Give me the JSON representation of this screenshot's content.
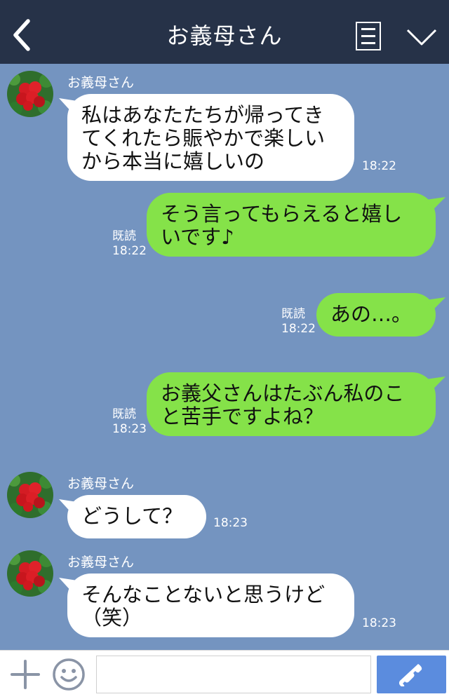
{
  "header": {
    "title": "お義母さん",
    "back_icon": "chevron-left-icon",
    "menu_icon": "menu-icon",
    "collapse_icon": "chevron-down-icon"
  },
  "messages": [
    {
      "direction": "in",
      "sender": "お義母さん",
      "text": "私はあなたたちが帰ってき\nてくれたら賑やかで楽しい\nから本当に嬉しいの",
      "time": "18:22"
    },
    {
      "direction": "out",
      "read": "既読",
      "text": "そう言ってもらえると嬉し\nいです♪",
      "time": "18:22"
    },
    {
      "direction": "out",
      "read": "既読",
      "text": "あの…。",
      "time": "18:22"
    },
    {
      "direction": "out",
      "read": "既読",
      "text": "お義父さんはたぶん私のこ\nと苦手ですよね？",
      "time": "18:23"
    },
    {
      "direction": "in",
      "sender": "お義母さん",
      "text": "どうして？",
      "time": "18:23"
    },
    {
      "direction": "in",
      "sender": "お義母さん",
      "text": "そんなことないと思うけど\n（笑）",
      "time": "18:23"
    }
  ],
  "footer": {
    "input_value": "",
    "plus_icon": "plus-icon",
    "emoji_icon": "smiley-icon",
    "call_icon": "phone-icon"
  },
  "colors": {
    "header_bg": "#263248",
    "chat_bg": "#7494c0",
    "incoming_bubble": "#ffffff",
    "outgoing_bubble": "#85e249",
    "call_button": "#5b8cde"
  }
}
